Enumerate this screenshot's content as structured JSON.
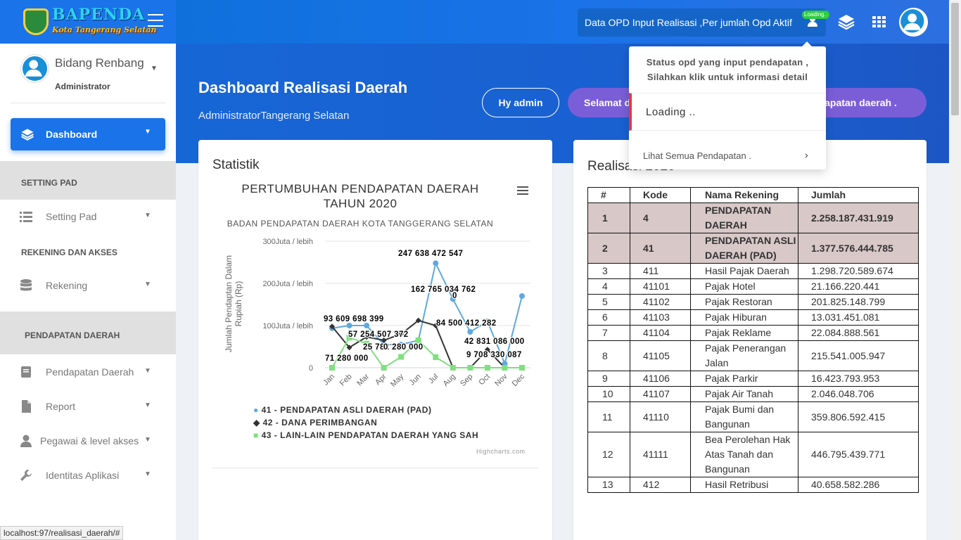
{
  "brand": {
    "name": "BAPENDA",
    "sub": "Kota Tangerang Selatan"
  },
  "topbar": {
    "opd_label": "Data OPD Input Realisasi ,Per jumlah Opd Aktif",
    "badge": "Loading.."
  },
  "user": {
    "name": "Bidang Renbang",
    "role": "Administrator"
  },
  "sidebar": {
    "dashboard": "Dashboard",
    "sec_setting": "SETTING PAD",
    "setting_pad": "Setting Pad",
    "sec_rekening": "REKENING DAN AKSES",
    "rekening": "Rekening",
    "sec_pendapatan": "PENDAPATAN DAERAH",
    "pendapatan": "Pendapatan Daerah",
    "report": "Report",
    "pegawai": "Pegawai & level akses",
    "identitas": "Identitas Aplikasi"
  },
  "hero": {
    "title": "Dashboard Realisasi Daerah",
    "subtitle": "AdministratorTangerang Selatan",
    "hy": "Hy admin",
    "welcome_a": "Selamat d",
    "welcome_b": "ndapatan daerah ."
  },
  "dropdown": {
    "head1": "Status opd yang input pendapatan ,",
    "head2": "Silahkan klik untuk informasi detail",
    "loading": "Loading ..",
    "footer": "Lihat Semua Pendapatan ."
  },
  "stat": {
    "title": "Statistik",
    "credit": "Highcharts.com"
  },
  "realisasi": {
    "title": "Realisasi 2020",
    "headers": [
      "#",
      "Kode",
      "Nama Rekening",
      "Jumlah"
    ],
    "rows": [
      {
        "no": "1",
        "kode": "4",
        "nama": "PENDAPATAN DAERAH",
        "jumlah": "2.258.187.431.919",
        "hl": true
      },
      {
        "no": "2",
        "kode": "41",
        "nama": "PENDAPATAN ASLI DAERAH (PAD)",
        "jumlah": "1.377.576.444.785",
        "hl": true
      },
      {
        "no": "3",
        "kode": "411",
        "nama": "Hasil Pajak Daerah",
        "jumlah": "1.298.720.589.674"
      },
      {
        "no": "4",
        "kode": "41101",
        "nama": "Pajak Hotel",
        "jumlah": "21.166.220.441"
      },
      {
        "no": "5",
        "kode": "41102",
        "nama": "Pajak Restoran",
        "jumlah": "201.825.148.799"
      },
      {
        "no": "6",
        "kode": "41103",
        "nama": "Pajak Hiburan",
        "jumlah": "13.031.451.081"
      },
      {
        "no": "7",
        "kode": "41104",
        "nama": "Pajak Reklame",
        "jumlah": "22.084.888.561"
      },
      {
        "no": "8",
        "kode": "41105",
        "nama": "Pajak Penerangan Jalan",
        "jumlah": "215.541.005.947"
      },
      {
        "no": "9",
        "kode": "41106",
        "nama": "Pajak Parkir",
        "jumlah": "16.423.793.953"
      },
      {
        "no": "10",
        "kode": "41107",
        "nama": "Pajak Air Tanah",
        "jumlah": "2.046.048.706"
      },
      {
        "no": "11",
        "kode": "41110",
        "nama": "Pajak Bumi dan Bangunan",
        "jumlah": "359.806.592.415"
      },
      {
        "no": "12",
        "kode": "41111",
        "nama": "Bea Perolehan Hak Atas Tanah dan Bangunan",
        "jumlah": "446.795.439.771"
      },
      {
        "no": "13",
        "kode": "412",
        "nama": "Hasil Retribusi",
        "jumlah": "40.658.582.286"
      }
    ]
  },
  "status_url": "localhost:97/realisasi_daerah/#",
  "chart_data": {
    "type": "line",
    "title": "PERTUMBUHAN PENDAPATAN DAERAH TAHUN 2020",
    "subtitle": "BADAN PENDAPATAN DAERAH KOTA TANGGERANG SELATAN",
    "ylabel": "Jumlah Pendaptan Dalam Rupiah (Rp)",
    "yticks": [
      "0",
      "100Juta / lebih",
      "200Juta / lebih",
      "300Juta / lebih"
    ],
    "ylim": [
      0,
      300000000000
    ],
    "categories": [
      "Jan",
      "Feb",
      "Mar",
      "Apr",
      "May",
      "Jun",
      "Jul",
      "Aug",
      "Sep",
      "Oct",
      "Nov",
      "Dec"
    ],
    "series": [
      {
        "name": "41 - PENDAPATAN ASLI DAERAH (PAD)",
        "color": "#5fa8e0",
        "marker": "circle",
        "values": [
          93609698399,
          100000000000,
          100000000000,
          55000000000,
          55000000000,
          65000000000,
          247638472547,
          162765034762,
          85000000000,
          110000000000,
          9708330087,
          170000000000
        ]
      },
      {
        "name": "42 - DANA PERIMBANGAN",
        "color": "#333333",
        "marker": "diamond",
        "values": [
          98000000000,
          48000000000,
          73000000000,
          65000000000,
          80000000000,
          112000000000,
          100000000000,
          0,
          0,
          42831086000,
          0,
          0
        ]
      },
      {
        "name": "43 - LAIN-LAIN PENDAPATAN DAERAH YANG SAH",
        "color": "#7ee07e",
        "marker": "square",
        "values": [
          0,
          71280000000,
          57254507372,
          0,
          25782280000,
          65000000000,
          25000000000,
          0,
          0,
          0,
          0,
          0
        ]
      }
    ],
    "data_labels": [
      "93 609 698 399",
      "71 280 000",
      "57 254 507 372",
      "25 782 280 000",
      "0",
      "247 638 472 547",
      "162 765 034 762",
      "84 500 412 282",
      "42 831 086 000",
      "0",
      "9 708 330 087"
    ],
    "legend_position": "bottom"
  }
}
